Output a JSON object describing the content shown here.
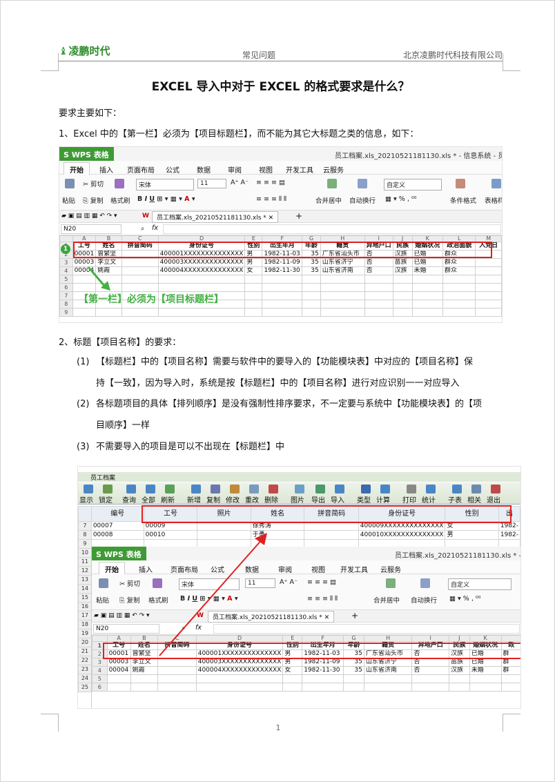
{
  "header": {
    "logo_text": "凌鹏时代",
    "section": "常见问题",
    "company": "北京凌鹏时代科技有限公司"
  },
  "title": "EXCEL 导入中对于 EXCEL 的格式要求是什么？",
  "intro": "要求主要如下：",
  "point1": "1、Excel 中的【第一栏】必须为【项目标题栏】，而不能为其它大标题之类的信息，如下：",
  "point2": "2、标题【项目名称】的要求：",
  "subitems": [
    {
      "num": "(1)",
      "line1": "【标题栏】中的【项目名称】需要与软件中的要导入的【功能模块表】中对应的【项目名称】保",
      "line2": "持【一致】，因为导入时，系统是按【标题栏】中的【项目名称】进行对应识别一一对应导入"
    },
    {
      "num": "(2)",
      "line1": "各标题项目的具体【排列顺序】是没有强制性排序要求，不一定要与系统中【功能模块表】的【项",
      "line2": "目顺序】一样"
    },
    {
      "num": "(3)",
      "line1": "不需要导入的项目是可以不出现在【标题栏】中",
      "line2": ""
    }
  ],
  "wps": {
    "app_tab": "S WPS 表格",
    "window_title": "员工档案.xls_20210521181130.xls * - 信息系统 - 员工档案",
    "menus": [
      "开始",
      "插入",
      "页面布局",
      "公式",
      "数据",
      "审阅",
      "视图",
      "开发工具",
      "云服务"
    ],
    "ribbon": {
      "paste": "粘贴",
      "cut": "剪切",
      "copy": "复制",
      "format_painter": "格式刷",
      "font": "宋体",
      "size": "11",
      "merge": "合并居中",
      "wrap": "自动换行",
      "number_format": "自定义",
      "cond_format": "条件格式",
      "table_style": "表格样"
    },
    "file_tab": "员工档案.xls_20210521181130.xls *",
    "cell_ref": "N20",
    "fx": "fx",
    "col_letters": [
      "A",
      "B",
      "C",
      "D",
      "E",
      "F",
      "G",
      "H",
      "I",
      "J",
      "K",
      "L",
      "M"
    ],
    "headers": [
      "工号",
      "姓名",
      "拼音简码",
      "身份证号",
      "性别",
      "出生年月",
      "年龄",
      "籍贯",
      "异地户口",
      "民族",
      "婚姻状况",
      "政治面貌",
      "入党日"
    ],
    "rows": [
      [
        "00001",
        "曾繁坚",
        "",
        "400001XXXXXXXXXXXXXX",
        "男",
        "1982-11-03",
        "35",
        "广东省汕头市",
        "否",
        "汉族",
        "已婚",
        "群众"
      ],
      [
        "00003",
        "李立文",
        "",
        "400003XXXXXXXXXXXXXX",
        "男",
        "1982-11-09",
        "35",
        "山东省济宁",
        "否",
        "苗族",
        "已婚",
        "群众"
      ],
      [
        "00004",
        "姚霞",
        "",
        "400004XXXXXXXXXXXXXX",
        "女",
        "1982-11-30",
        "35",
        "山东省济南",
        "否",
        "汉族",
        "未婚",
        "群众"
      ]
    ],
    "row_numbers": [
      "1",
      "2",
      "3",
      "4",
      "5",
      "6",
      "7",
      "8",
      "9"
    ],
    "annotation": "【第一栏】必须为【项目标题栏】",
    "circle": "1"
  },
  "sys": {
    "window_title": "员工档案",
    "toolbar": [
      "显示",
      "锁定",
      "查询",
      "全部",
      "刷新",
      "新增",
      "复制",
      "修改",
      "重改",
      "删除",
      "图片",
      "导出",
      "导入",
      "类型",
      "计算",
      "打印",
      "统计",
      "子表",
      "相关",
      "退出"
    ],
    "headers": [
      "编号",
      "工号",
      "照片",
      "姓名",
      "拼音简码",
      "身份证号",
      "性别",
      "出"
    ],
    "rows": [
      {
        "rn": "7",
        "cells": [
          "00007",
          "00009",
          "",
          "徐秀涛",
          "",
          "400009XXXXXXXXXXXXXX",
          "女",
          "1982-"
        ]
      },
      {
        "rn": "8",
        "cells": [
          "00008",
          "00010",
          "",
          "于勇",
          "",
          "400010XXXXXXXXXXXXXX",
          "男",
          "1982-"
        ]
      }
    ],
    "row_numbers": [
      "9",
      "10",
      "11",
      "12",
      "13",
      "14",
      "15",
      "16",
      "17",
      "18",
      "19",
      "20",
      "21",
      "22",
      "23",
      "24",
      "25"
    ]
  },
  "wps2": {
    "col_letters": [
      "A",
      "B",
      "C",
      "D",
      "E",
      "F",
      "G",
      "H",
      "I",
      "J",
      "K"
    ],
    "headers": [
      "工号",
      "姓名",
      "拼音简码",
      "身份证号",
      "性别",
      "出生年月",
      "年龄",
      "籍贯",
      "异地户口",
      "民族",
      "婚姻状况",
      "政"
    ],
    "rows": [
      [
        "00001",
        "曾繁坚",
        "",
        "400001XXXXXXXXXXXXXX",
        "男",
        "1982-11-03",
        "35",
        "广东省汕头市",
        "否",
        "汉族",
        "已婚",
        "群"
      ],
      [
        "00003",
        "李立文",
        "",
        "400003XXXXXXXXXXXXXX",
        "男",
        "1982-11-09",
        "35",
        "山东省济宁",
        "否",
        "苗族",
        "已婚",
        "群"
      ],
      [
        "00004",
        "姚霞",
        "",
        "400004XXXXXXXXXXXXXX",
        "女",
        "1982-11-30",
        "35",
        "山东省济南",
        "否",
        "汉族",
        "未婚",
        "群"
      ]
    ],
    "row_numbers": [
      "1",
      "2",
      "3",
      "4",
      "5",
      "6"
    ]
  },
  "page_number": "1"
}
